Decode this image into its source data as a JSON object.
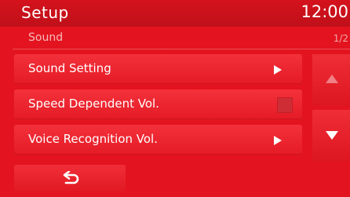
{
  "header": {
    "title": "Setup",
    "clock": "12:00"
  },
  "section": {
    "title": "Sound",
    "page": "1/2"
  },
  "menu": {
    "items": [
      {
        "label": "Sound Setting",
        "control": "arrow"
      },
      {
        "label": "Speed Dependent Vol.",
        "control": "checkbox",
        "checked": false
      },
      {
        "label": "Voice Recognition Vol.",
        "control": "arrow"
      }
    ]
  },
  "scroll": {
    "up_icon": "triangle-up",
    "down_icon": "triangle-down"
  },
  "footer": {
    "back_icon": "return-arrow"
  },
  "colors": {
    "background": "#e3141f",
    "text": "#ffffff",
    "subtext": "#f6b9bc"
  }
}
